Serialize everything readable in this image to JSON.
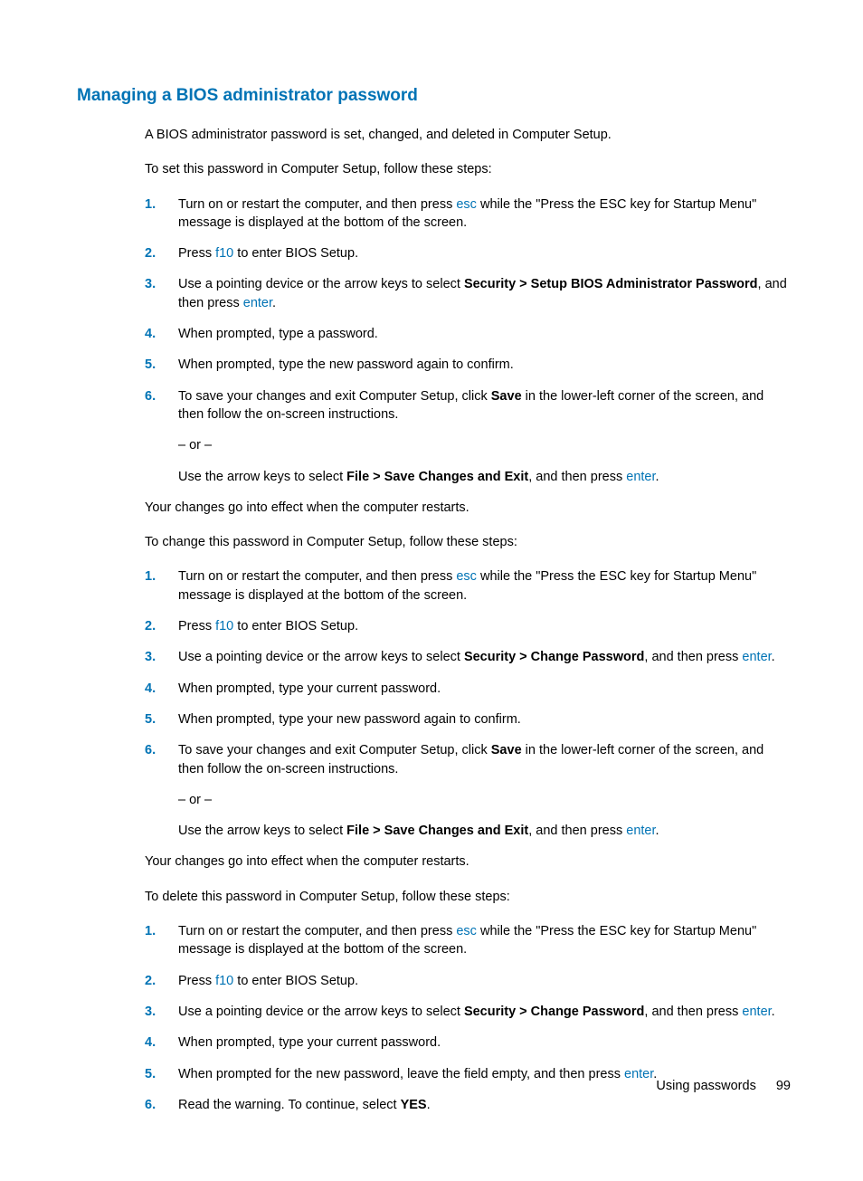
{
  "heading": "Managing a BIOS administrator password",
  "intro1": "A BIOS administrator password is set, changed, and deleted in Computer Setup.",
  "set_intro": "To set this password in Computer Setup, follow these steps:",
  "change_intro": "To change this password in Computer Setup, follow these steps:",
  "delete_intro": "To delete this password in Computer Setup, follow these steps:",
  "restart_note": "Your changes go into effect when the computer restarts.",
  "or_text": "– or –",
  "keys": {
    "esc": "esc",
    "f10": "f10",
    "enter": "enter"
  },
  "bold": {
    "setup_admin": "Security > Setup BIOS Administrator Password",
    "change_pw": "Security > Change Password",
    "save": "Save",
    "file_exit": "File > Save Changes and Exit",
    "yes": "YES"
  },
  "steps_set": {
    "s1a": "Turn on or restart the computer, and then press ",
    "s1b": " while the \"Press the ESC key for Startup Menu\" message is displayed at the bottom of the screen.",
    "s2a": "Press ",
    "s2b": " to enter BIOS Setup.",
    "s3a": "Use a pointing device or the arrow keys to select ",
    "s3b": ", and then press ",
    "s3c": ".",
    "s4": "When prompted, type a password.",
    "s5": "When prompted, type the new password again to confirm.",
    "s6a": "To save your changes and exit Computer Setup, click ",
    "s6b": " in the lower-left corner of the screen, and then follow the on-screen instructions.",
    "s6c": "Use the arrow keys to select ",
    "s6d": ", and then press ",
    "s6e": "."
  },
  "steps_change": {
    "s1a": "Turn on or restart the computer, and then press ",
    "s1b": " while the \"Press the ESC key for Startup Menu\" message is displayed at the bottom of the screen.",
    "s2a": "Press ",
    "s2b": " to enter BIOS Setup.",
    "s3a": "Use a pointing device or the arrow keys to select ",
    "s3b": ", and then press ",
    "s3c": ".",
    "s4": "When prompted, type your current password.",
    "s5": "When prompted, type your new password again to confirm.",
    "s6a": "To save your changes and exit Computer Setup, click ",
    "s6b": " in the lower-left corner of the screen, and then follow the on-screen instructions.",
    "s6c": "Use the arrow keys to select ",
    "s6d": ", and then press ",
    "s6e": "."
  },
  "steps_delete": {
    "s1a": "Turn on or restart the computer, and then press ",
    "s1b": " while the \"Press the ESC key for Startup Menu\" message is displayed at the bottom of the screen.",
    "s2a": "Press ",
    "s2b": " to enter BIOS Setup.",
    "s3a": "Use a pointing device or the arrow keys to select ",
    "s3b": ", and then press ",
    "s3c": ".",
    "s4": "When prompted, type your current password.",
    "s5a": "When prompted for the new password, leave the field empty, and then press ",
    "s5b": ".",
    "s6a": "Read the warning. To continue, select ",
    "s6b": "."
  },
  "nums": {
    "n1": "1.",
    "n2": "2.",
    "n3": "3.",
    "n4": "4.",
    "n5": "5.",
    "n6": "6."
  },
  "footer": {
    "section": "Using passwords",
    "page": "99"
  }
}
